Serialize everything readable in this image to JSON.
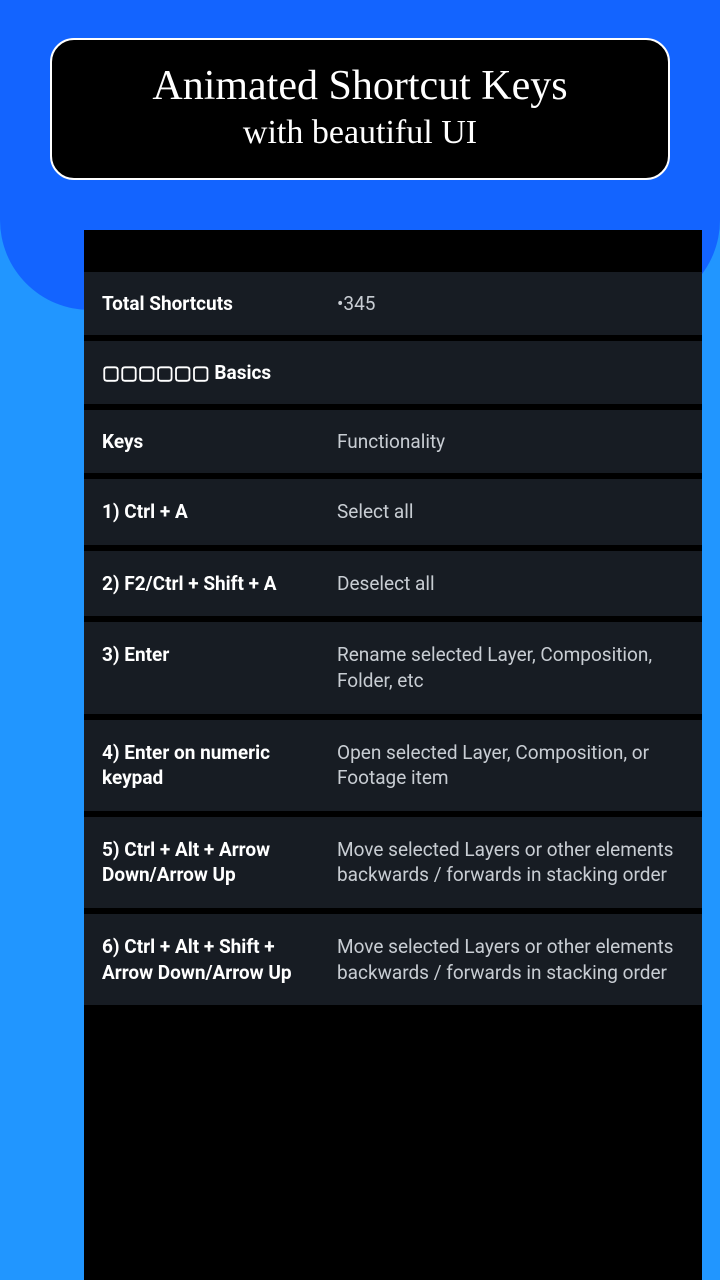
{
  "banner": {
    "title": "Animated Shortcut Keys",
    "subtitle": "with beautiful UI"
  },
  "summary": {
    "label": "Total Shortcuts",
    "value": "•345"
  },
  "category": {
    "label": "▢▢▢▢▢▢ Basics"
  },
  "table": {
    "keys_header": "Keys",
    "func_header": "Functionality",
    "rows": [
      {
        "key": "1)  Ctrl + A",
        "func": "Select all"
      },
      {
        "key": "2)  F2/Ctrl + Shift + A",
        "func": "Deselect all"
      },
      {
        "key": "3)  Enter",
        "func": "Rename selected Layer, Composition, Folder, etc"
      },
      {
        "key": "4)  Enter on numeric keypad",
        "func": "Open selected Layer, Composition, or Footage item"
      },
      {
        "key": "5)  Ctrl + Alt + Arrow Down/Arrow Up",
        "func": "Move selected Layers or other elements backwards / forwards in stacking order"
      },
      {
        "key": "6)  Ctrl + Alt + Shift + Arrow Down/Arrow Up",
        "func": "Move selected Layers or other elements backwards / forwards in stacking order"
      }
    ]
  }
}
